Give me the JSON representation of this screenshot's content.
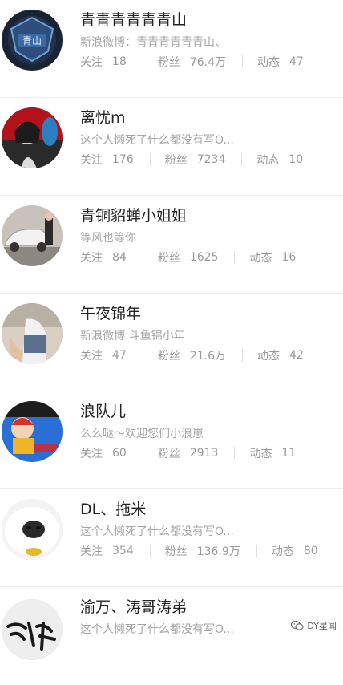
{
  "labels": {
    "follow": "关注",
    "fans": "粉丝",
    "posts": "动态"
  },
  "users": [
    {
      "name": "青青青青青青山",
      "bio": "新浪微博：青青青青青青山、",
      "follow": "18",
      "fans": "76.4万",
      "posts": "47",
      "avatar_icon": "game-logo-avatar"
    },
    {
      "name": "离忧m",
      "bio": "这个人懒死了什么都没有写O...",
      "follow": "176",
      "fans": "7234",
      "posts": "10",
      "avatar_icon": "portrait-avatar"
    },
    {
      "name": "青铜貂蝉小姐姐",
      "bio": "等风也等你",
      "follow": "84",
      "fans": "1625",
      "posts": "16",
      "avatar_icon": "car-photo-avatar"
    },
    {
      "name": "午夜锦年",
      "bio": "新浪微博:斗鱼锦小年",
      "follow": "47",
      "fans": "21.6万",
      "posts": "42",
      "avatar_icon": "portrait-avatar"
    },
    {
      "name": "浪队儿",
      "bio": "么么哒～欢迎您们小浪崽",
      "follow": "60",
      "fans": "2913",
      "posts": "11",
      "avatar_icon": "cartoon-avatar"
    },
    {
      "name": "DL、拖米",
      "bio": "这个人懒死了什么都没有写O...",
      "follow": "354",
      "fans": "136.9万",
      "posts": "80",
      "avatar_icon": "dog-avatar"
    },
    {
      "name": "渝万、涛哥涛弟",
      "bio": "这个人懒死了什么都没有写O...",
      "follow": "",
      "fans": "",
      "posts": "",
      "avatar_icon": "calligraphy-avatar"
    }
  ],
  "watermark": {
    "text": "DY星闻",
    "icon": "wechat-icon"
  }
}
